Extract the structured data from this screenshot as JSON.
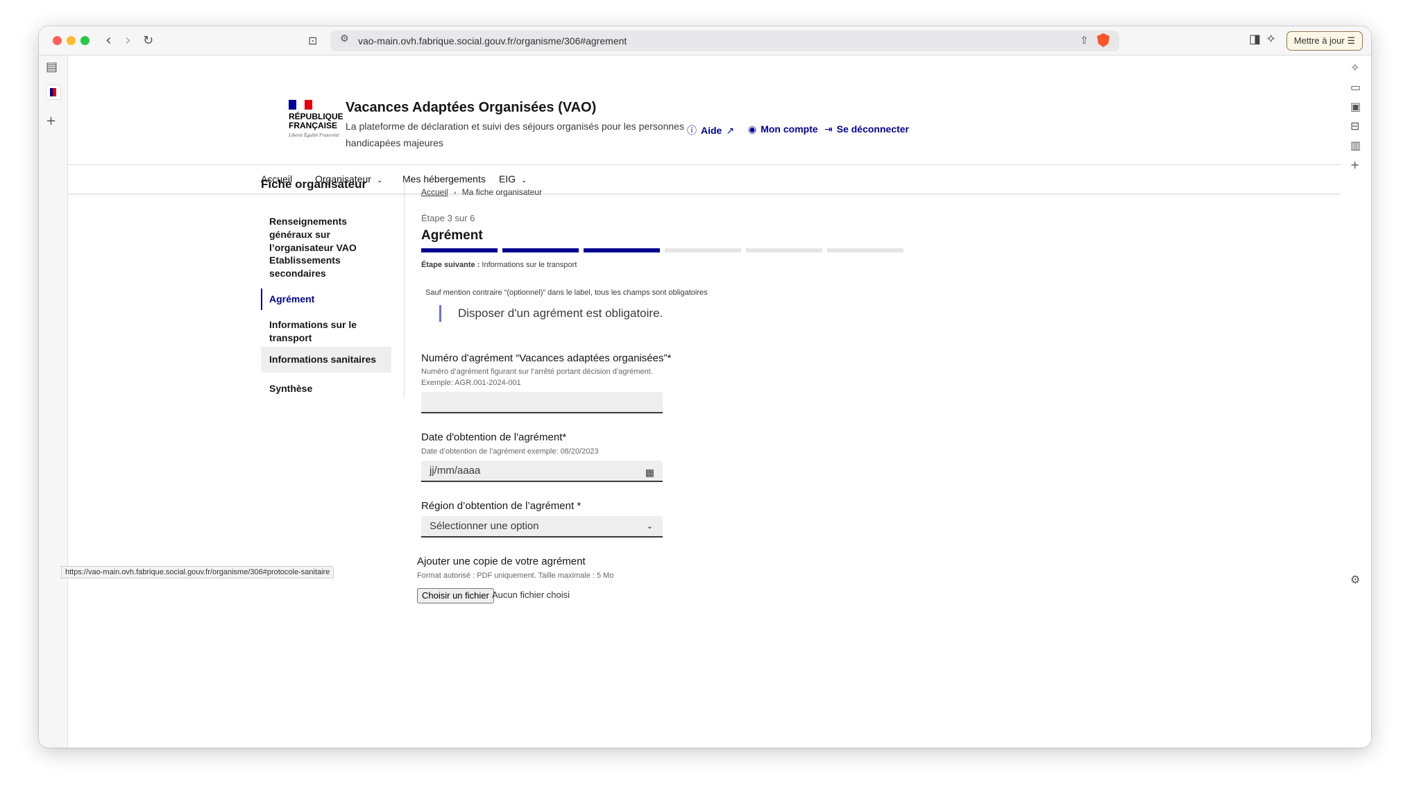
{
  "browser": {
    "url": "vao-main.ovh.fabrique.social.gouv.fr/organisme/306#agrement",
    "update_button": "Mettre à jour",
    "status_url": "https://vao-main.ovh.fabrique.social.gouv.fr/organisme/306#protocole-sanitaire"
  },
  "header": {
    "logo_text": "RÉPUBLIQUE FRANÇAISE",
    "logo_motto": "Liberté Égalité Fraternité",
    "title": "Vacances Adaptées Organisées (VAO)",
    "subtitle": "La plateforme de déclaration et suivi des séjours organisés pour les personnes handicapées majeures",
    "links": {
      "help": "Aide",
      "account": "Mon compte",
      "logout": "Se déconnecter"
    }
  },
  "nav": {
    "home": "Accueil",
    "organizer": "Organisateur",
    "housing": "Mes hébergements",
    "eig": "EIG"
  },
  "side_menu": {
    "title": "Fiche organisateur",
    "items": [
      "Renseignements généraux sur l’organisateur VAO",
      "Etablissements secondaires",
      "Agrément",
      "Informations sur le transport",
      "Informations sanitaires",
      "Synthèse"
    ]
  },
  "breadcrumb": {
    "home": "Accueil",
    "current": "Ma fiche organisateur"
  },
  "stepper": {
    "label": "Étape 3 sur 6",
    "title": "Agrément",
    "total": 6,
    "current": 3,
    "next_label": "Étape suivante :",
    "next_value": "Informations sur le transport"
  },
  "form": {
    "hint": "Sauf mention contraire “(optionnel)” dans le label, tous les champs sont obligatoires",
    "callout": "Disposer d'un agrément est obligatoire.",
    "number_label": "Numéro d'agrément “Vacances adaptées organisées”*",
    "number_help_1": "Numéro d’agrément figurant sur l’arrêté portant décision d’agrément.",
    "number_help_2": "Exemple: AGR.001-2024-001",
    "number_value": "",
    "date_label": "Date d'obtention de l'agrément*",
    "date_help": "Date d’obtention de l’agrément exemple: 08/20/2023",
    "date_placeholder": "jj/mm/aaaa",
    "region_label": "Région d’obtention de l’agrément  *",
    "region_value": "Sélectionner une option",
    "file_label": "Ajouter une copie de votre agrément",
    "file_help": "Format autorisé : PDF uniquement. Taille maximale : 5 Mo",
    "file_button": "Choisir un fichier",
    "file_none": "Aucun fichier choisi"
  },
  "colors": {
    "accent": "#000091",
    "callout_border": "#6a6af4",
    "flag_blue": "#000091",
    "flag_red": "#e1000f"
  }
}
